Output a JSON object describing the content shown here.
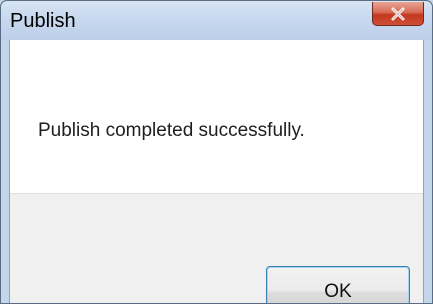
{
  "window": {
    "title": "Publish"
  },
  "title_bar": {
    "close_icon": "close-icon"
  },
  "dialog": {
    "message": "Publish completed successfully.",
    "ok_label": "OK"
  },
  "colors": {
    "title_bar": "#c7d8ee",
    "close_button": "#c4381f",
    "content_background": "#ffffff",
    "footer_background": "#f0f0f0",
    "focus_border": "#3c7fb1"
  }
}
